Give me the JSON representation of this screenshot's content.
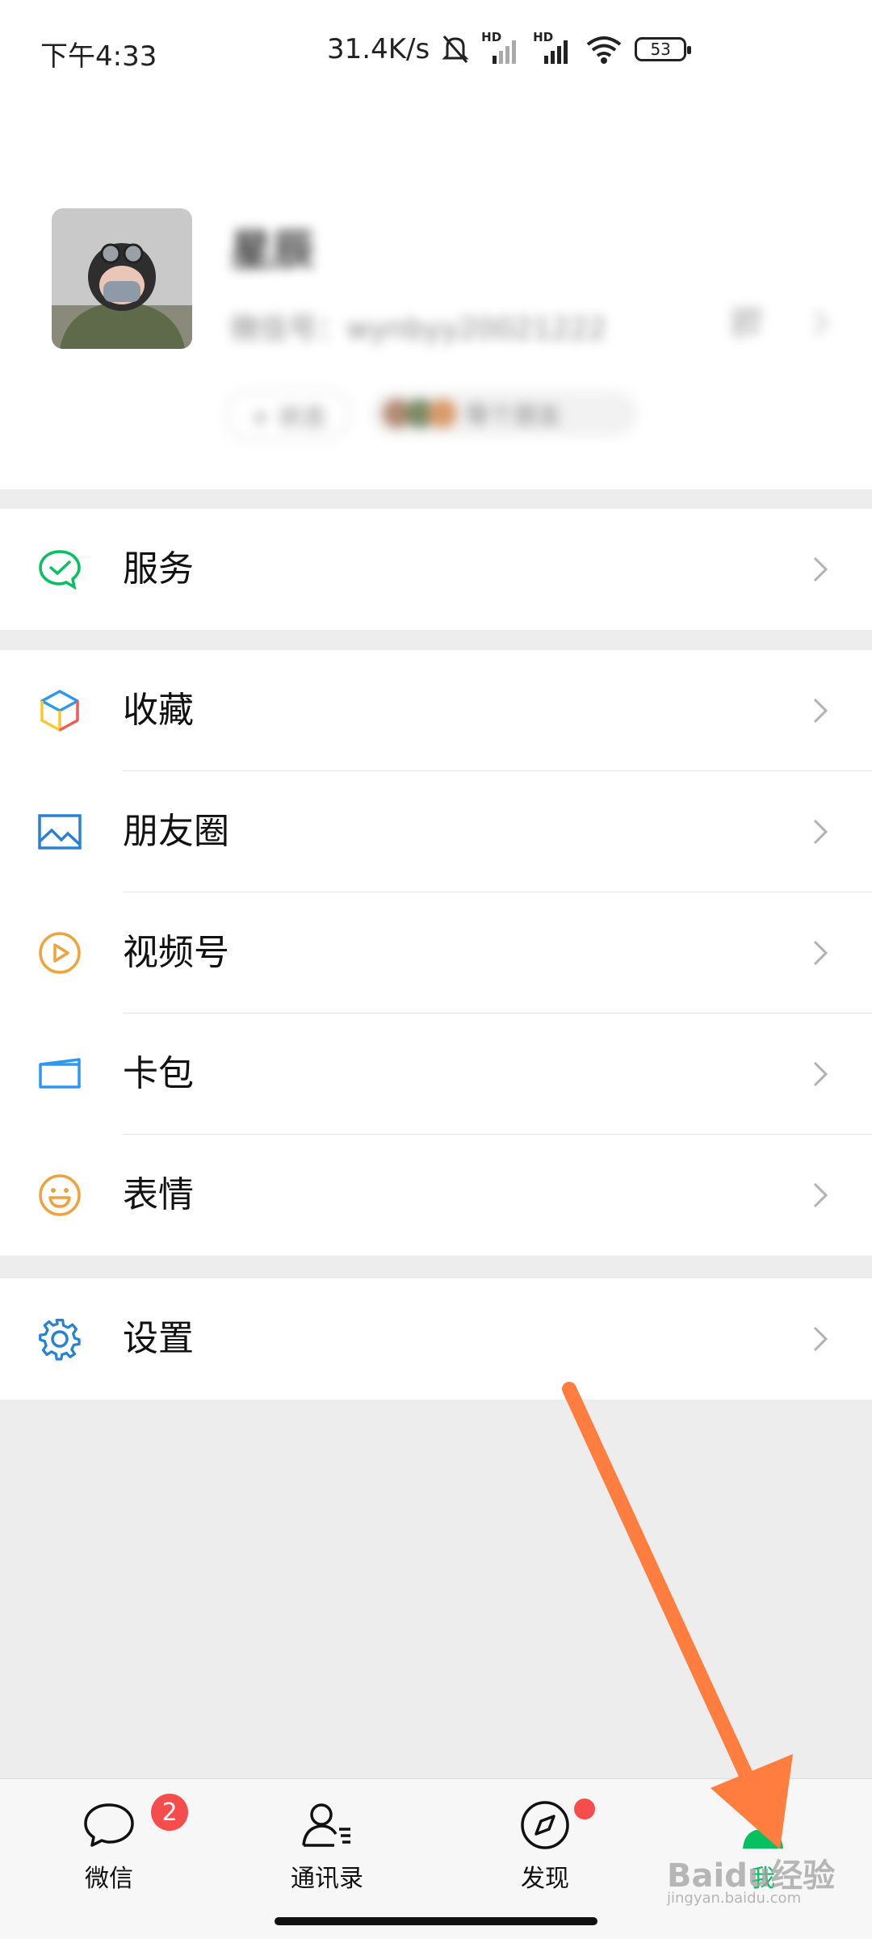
{
  "status_bar": {
    "time": "下午4:33",
    "net_speed": "31.4K/s",
    "hd1": "HD",
    "hd2": "HD",
    "battery": "53"
  },
  "profile": {
    "name": "星辰",
    "wechat_id": "微信号：wynbyy20021222",
    "status_label": "+ 状态",
    "friends_label": "等个朋友"
  },
  "menu": {
    "service": "服务",
    "favorites": "收藏",
    "moments": "朋友圈",
    "channels": "视频号",
    "card_wallet": "卡包",
    "stickers": "表情",
    "settings": "设置"
  },
  "tabs": {
    "chats": "微信",
    "chats_badge": "2",
    "contacts": "通讯录",
    "discover": "发现",
    "me": "我"
  },
  "watermark": {
    "brand": "Baidu经验",
    "url": "jingyan.baidu.com"
  },
  "colors": {
    "accent": "#07c160",
    "arrow": "#ff7d3e",
    "badge": "#f74c4c"
  }
}
